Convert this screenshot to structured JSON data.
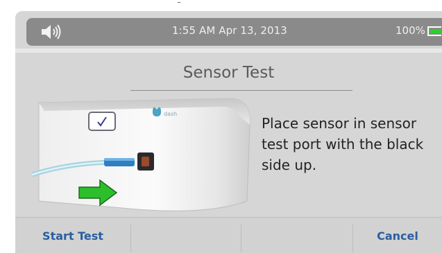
{
  "status_bar": {
    "volume_icon": "speaker-icon",
    "datetime": "1:55 AM  Apr 13, 2013",
    "battery_percent": "100%",
    "battery_icon": "battery-icon",
    "battery_level": 1.0,
    "battery_color": "#2ecc2e"
  },
  "screen": {
    "title": "Sensor Test",
    "instruction": "Place sensor in sensor test port with the black side up.",
    "brand_mark": "dash",
    "arrow_color": "#2dbe2d"
  },
  "softkeys": {
    "left": "Start Test",
    "mid_left": "",
    "mid_right": "",
    "right": "Cancel"
  }
}
